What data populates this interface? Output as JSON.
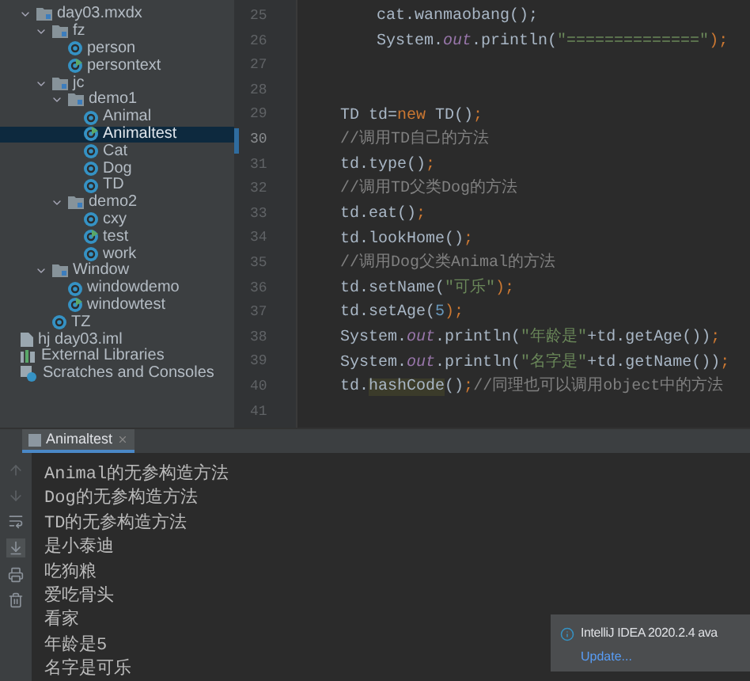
{
  "project_tree": [
    {
      "label": "day03.mxdx",
      "kind": "folder",
      "expanded": true,
      "selected": false,
      "children": [
        {
          "label": "fz",
          "kind": "folder",
          "expanded": true,
          "selected": false,
          "children": [
            {
              "label": "person",
              "kind": "class",
              "selected": false
            },
            {
              "label": "persontext",
              "kind": "runnable",
              "selected": false
            }
          ]
        },
        {
          "label": "jc",
          "kind": "folder",
          "expanded": true,
          "selected": false,
          "children": [
            {
              "label": "demo1",
              "kind": "folder",
              "expanded": true,
              "selected": false,
              "children": [
                {
                  "label": "Animal",
                  "kind": "class",
                  "selected": false
                },
                {
                  "label": "Animaltest",
                  "kind": "runnable",
                  "selected": true
                },
                {
                  "label": "Cat",
                  "kind": "class",
                  "selected": false
                },
                {
                  "label": "Dog",
                  "kind": "class",
                  "selected": false
                },
                {
                  "label": "TD",
                  "kind": "class",
                  "selected": false
                }
              ]
            },
            {
              "label": "demo2",
              "kind": "folder",
              "expanded": true,
              "selected": false,
              "children": [
                {
                  "label": "cxy",
                  "kind": "class",
                  "selected": false
                },
                {
                  "label": "test",
                  "kind": "runnable",
                  "selected": false
                },
                {
                  "label": "work",
                  "kind": "class",
                  "selected": false
                }
              ]
            }
          ]
        },
        {
          "label": "Window",
          "kind": "folder",
          "expanded": true,
          "selected": false,
          "children": [
            {
              "label": "windowdemo",
              "kind": "class",
              "selected": false
            },
            {
              "label": "windowtest",
              "kind": "runnable",
              "selected": false
            }
          ]
        },
        {
          "label": "TZ",
          "kind": "class",
          "selected": false
        }
      ]
    },
    {
      "label": "hj day03.iml",
      "kind": "module-file",
      "selected": false
    },
    {
      "label": "External Libraries",
      "kind": "libraries",
      "selected": false
    },
    {
      "label": "Scratches and Consoles",
      "kind": "scratches",
      "selected": false
    }
  ],
  "editor": {
    "lines": [
      {
        "number": "25",
        "indented": true,
        "current": false,
        "segments": [
          {
            "text": "cat.wanmaobang();",
            "kind": "plain"
          }
        ]
      },
      {
        "number": "26",
        "indented": true,
        "current": false,
        "segments": [
          {
            "text": "System.",
            "kind": "plain"
          },
          {
            "text": "out",
            "kind": "field"
          },
          {
            "text": ".println(",
            "kind": "plain"
          },
          {
            "text": "\"==============\"",
            "kind": "string"
          },
          {
            "text": ");",
            "kind": "punct"
          }
        ]
      },
      {
        "number": "27",
        "current": false
      },
      {
        "number": "28",
        "current": false
      },
      {
        "number": "29",
        "indented": false,
        "current": false,
        "segments": [
          {
            "text": "TD td=",
            "kind": "plain"
          },
          {
            "text": "new",
            "kind": "keyword"
          },
          {
            "text": " TD()",
            "kind": "plain"
          },
          {
            "text": ";",
            "kind": "punct"
          }
        ]
      },
      {
        "number": "30",
        "indented": false,
        "current": true,
        "segments": [
          {
            "text": "//调用TD自己的方法",
            "kind": "comment"
          }
        ]
      },
      {
        "number": "31",
        "indented": false,
        "current": false,
        "segments": [
          {
            "text": "td.type()",
            "kind": "plain"
          },
          {
            "text": ";",
            "kind": "punct"
          }
        ]
      },
      {
        "number": "32",
        "indented": false,
        "current": false,
        "segments": [
          {
            "text": "//调用TD父类Dog的方法",
            "kind": "comment"
          }
        ]
      },
      {
        "number": "33",
        "indented": false,
        "current": false,
        "segments": [
          {
            "text": "td.eat()",
            "kind": "plain"
          },
          {
            "text": ";",
            "kind": "punct"
          }
        ]
      },
      {
        "number": "34",
        "indented": false,
        "current": false,
        "segments": [
          {
            "text": "td.lookHome()",
            "kind": "plain"
          },
          {
            "text": ";",
            "kind": "punct"
          }
        ]
      },
      {
        "number": "35",
        "indented": false,
        "current": false,
        "segments": [
          {
            "text": "//调用Dog父类Animal的方法",
            "kind": "comment"
          }
        ]
      },
      {
        "number": "36",
        "indented": false,
        "current": false,
        "segments": [
          {
            "text": "td.setName(",
            "kind": "plain"
          },
          {
            "text": "\"可乐\"",
            "kind": "string"
          },
          {
            "text": ");",
            "kind": "punct"
          }
        ]
      },
      {
        "number": "37",
        "indented": false,
        "current": false,
        "segments": [
          {
            "text": "td.setAge(",
            "kind": "plain"
          },
          {
            "text": "5",
            "kind": "number"
          },
          {
            "text": ");",
            "kind": "punct"
          }
        ]
      },
      {
        "number": "38",
        "indented": false,
        "current": false,
        "segments": [
          {
            "text": "System.",
            "kind": "plain"
          },
          {
            "text": "out",
            "kind": "field"
          },
          {
            "text": ".println(",
            "kind": "plain"
          },
          {
            "text": "\"年龄是\"",
            "kind": "string"
          },
          {
            "text": "+td.getAge())",
            "kind": "plain"
          },
          {
            "text": ";",
            "kind": "punct"
          }
        ]
      },
      {
        "number": "39",
        "indented": false,
        "current": false,
        "segments": [
          {
            "text": "System.",
            "kind": "plain"
          },
          {
            "text": "out",
            "kind": "field"
          },
          {
            "text": ".println(",
            "kind": "plain"
          },
          {
            "text": "\"名字是\"",
            "kind": "string"
          },
          {
            "text": "+td.getName())",
            "kind": "plain"
          },
          {
            "text": ";",
            "kind": "punct"
          }
        ]
      },
      {
        "number": "40",
        "indented": false,
        "current": false,
        "segments": [
          {
            "text": "td.",
            "kind": "plain"
          },
          {
            "text": "hashCode",
            "kind": "highlight"
          },
          {
            "text": "()",
            "kind": "plain"
          },
          {
            "text": ";",
            "kind": "punct"
          },
          {
            "text": "//同理也可以调用object中的方法",
            "kind": "comment"
          }
        ]
      },
      {
        "number": "41",
        "current": false
      }
    ]
  },
  "run_tabs": [
    {
      "label": "Animaltest",
      "selected": true
    }
  ],
  "console": {
    "lines": [
      "Animal的无参构造方法",
      "Dog的无参构造方法",
      "TD的无参构造方法",
      "是小泰迪",
      "吃狗粮",
      "爱吃骨头",
      "看家",
      "年龄是5",
      "名字是可乐"
    ]
  },
  "notification": {
    "title": "IntelliJ IDEA 2020.2.4 ava",
    "link": "Update..."
  }
}
